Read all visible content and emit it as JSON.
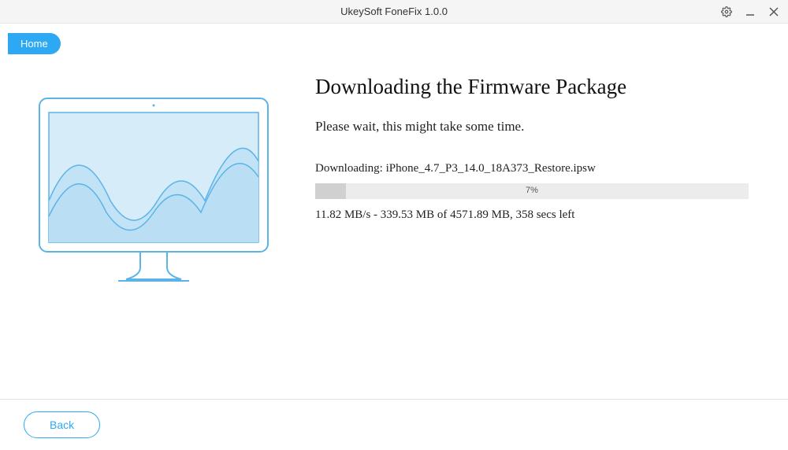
{
  "titlebar": {
    "title": "UkeySoft FoneFix 1.0.0"
  },
  "nav": {
    "home_label": "Home"
  },
  "main": {
    "title": "Downloading the Firmware Package",
    "subtitle": "Please wait, this might take some time.",
    "download_label": "Downloading: iPhone_4.7_P3_14.0_18A373_Restore.ipsw",
    "progress_percent_text": "7%",
    "progress_percent_value": 7,
    "download_stats": "11.82 MB/s - 339.53 MB of 4571.89 MB, 358 secs left"
  },
  "footer": {
    "back_label": "Back"
  },
  "colors": {
    "accent": "#2DA8F2"
  }
}
